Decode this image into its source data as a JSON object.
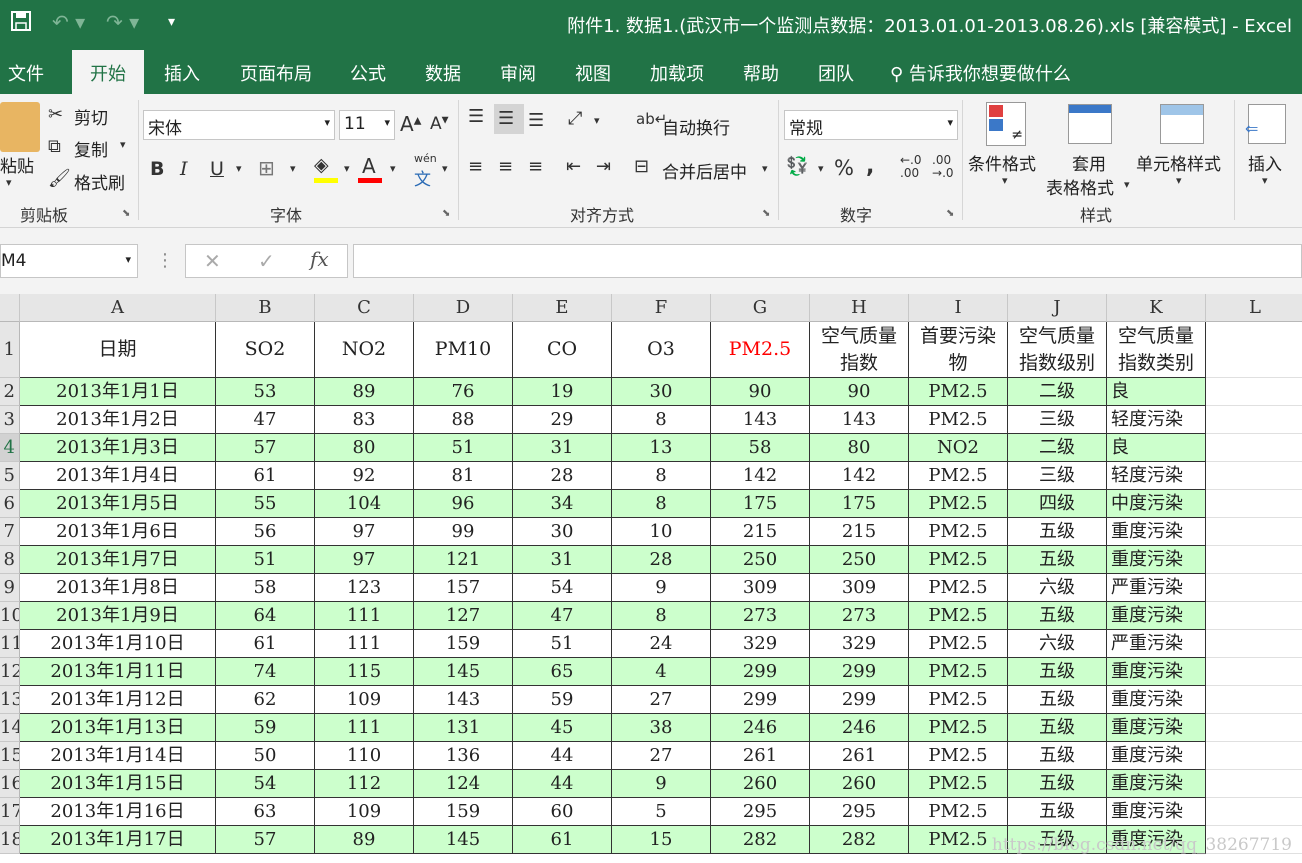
{
  "window": {
    "title": "附件1. 数据1.(武汉市一个监测点数据：2013.01.01-2013.08.26).xls  [兼容模式]  -  Excel"
  },
  "tabs": [
    "文件",
    "开始",
    "插入",
    "页面布局",
    "公式",
    "数据",
    "审阅",
    "视图",
    "加载项",
    "帮助",
    "团队"
  ],
  "tell_me": "告诉我你想要做什么",
  "clipboard": {
    "paste_label": "粘贴",
    "cut_label": "剪切",
    "copy_label": "复制",
    "format_painter_label": "格式刷",
    "group_label": "剪贴板"
  },
  "font": {
    "name": "宋体",
    "size": "11",
    "bold": "B",
    "italic": "I",
    "underline": "U",
    "phonetic": "wén",
    "group_label": "字体"
  },
  "alignment": {
    "wrap_text_label": "自动换行",
    "merge_center_label": "合并后居中",
    "group_label": "对齐方式"
  },
  "number": {
    "format": "常规",
    "percent": "%",
    "comma": ",",
    "inc_decimal": ".00",
    "dec_decimal": ".0",
    "group_label": "数字"
  },
  "styles": {
    "conditional_label": "条件格式",
    "table_label_1": "套用",
    "table_label_2": "表格格式",
    "cell_styles_label": "单元格样式",
    "group_label": "样式"
  },
  "cells": {
    "insert_label": "插入"
  },
  "formula_bar": {
    "name_box": "M4",
    "fx": "fx",
    "content": ""
  },
  "grid": {
    "columns": [
      "A",
      "B",
      "C",
      "D",
      "E",
      "F",
      "G",
      "H",
      "I",
      "J",
      "K",
      "L"
    ],
    "headers": [
      "日期",
      "SO2",
      "NO2",
      "PM10",
      "CO",
      "O3",
      "PM2.5",
      "空气质量指数",
      "首要污染物",
      "空气质量指数级别",
      "空气质量指数类别"
    ],
    "highlight_color": "#ccffcc",
    "pm25_color": "#ff0000",
    "rows": [
      [
        "2013年1月1日",
        "53",
        "89",
        "76",
        "19",
        "30",
        "90",
        "90",
        "PM2.5",
        "二级",
        "良"
      ],
      [
        "2013年1月2日",
        "47",
        "83",
        "88",
        "29",
        "8",
        "143",
        "143",
        "PM2.5",
        "三级",
        "轻度污染"
      ],
      [
        "2013年1月3日",
        "57",
        "80",
        "51",
        "31",
        "13",
        "58",
        "80",
        "NO2",
        "二级",
        "良"
      ],
      [
        "2013年1月4日",
        "61",
        "92",
        "81",
        "28",
        "8",
        "142",
        "142",
        "PM2.5",
        "三级",
        "轻度污染"
      ],
      [
        "2013年1月5日",
        "55",
        "104",
        "96",
        "34",
        "8",
        "175",
        "175",
        "PM2.5",
        "四级",
        "中度污染"
      ],
      [
        "2013年1月6日",
        "56",
        "97",
        "99",
        "30",
        "10",
        "215",
        "215",
        "PM2.5",
        "五级",
        "重度污染"
      ],
      [
        "2013年1月7日",
        "51",
        "97",
        "121",
        "31",
        "28",
        "250",
        "250",
        "PM2.5",
        "五级",
        "重度污染"
      ],
      [
        "2013年1月8日",
        "58",
        "123",
        "157",
        "54",
        "9",
        "309",
        "309",
        "PM2.5",
        "六级",
        "严重污染"
      ],
      [
        "2013年1月9日",
        "64",
        "111",
        "127",
        "47",
        "8",
        "273",
        "273",
        "PM2.5",
        "五级",
        "重度污染"
      ],
      [
        "2013年1月10日",
        "61",
        "111",
        "159",
        "51",
        "24",
        "329",
        "329",
        "PM2.5",
        "六级",
        "严重污染"
      ],
      [
        "2013年1月11日",
        "74",
        "115",
        "145",
        "65",
        "4",
        "299",
        "299",
        "PM2.5",
        "五级",
        "重度污染"
      ],
      [
        "2013年1月12日",
        "62",
        "109",
        "143",
        "59",
        "27",
        "299",
        "299",
        "PM2.5",
        "五级",
        "重度污染"
      ],
      [
        "2013年1月13日",
        "59",
        "111",
        "131",
        "45",
        "38",
        "246",
        "246",
        "PM2.5",
        "五级",
        "重度污染"
      ],
      [
        "2013年1月14日",
        "50",
        "110",
        "136",
        "44",
        "27",
        "261",
        "261",
        "PM2.5",
        "五级",
        "重度污染"
      ],
      [
        "2013年1月15日",
        "54",
        "112",
        "124",
        "44",
        "9",
        "260",
        "260",
        "PM2.5",
        "五级",
        "重度污染"
      ],
      [
        "2013年1月16日",
        "63",
        "109",
        "159",
        "60",
        "5",
        "295",
        "295",
        "PM2.5",
        "五级",
        "重度污染"
      ],
      [
        "2013年1月17日",
        "57",
        "89",
        "145",
        "61",
        "15",
        "282",
        "282",
        "PM2.5",
        "五级",
        "重度污染"
      ]
    ],
    "row_numbers": [
      "1",
      "2",
      "3",
      "4",
      "5",
      "6",
      "7",
      "8",
      "9",
      "10",
      "11",
      "12",
      "13",
      "14",
      "15",
      "16",
      "17",
      "18"
    ]
  },
  "watermark": "https://blog.csdn.net/qq_38267719"
}
